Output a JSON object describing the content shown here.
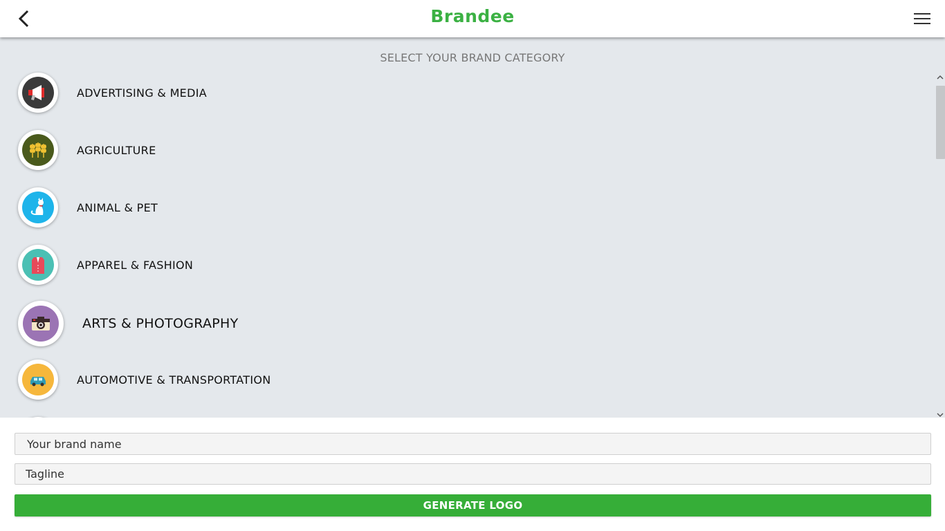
{
  "header": {
    "logo_text": "Brandee",
    "back_icon": "chevron-left-icon",
    "menu_icon": "hamburger-menu-icon"
  },
  "main": {
    "title": "SELECT YOUR BRAND CATEGORY",
    "categories": [
      {
        "label": "ADVERTISING & MEDIA",
        "icon": "megaphone-icon",
        "color": "#3a3a3a"
      },
      {
        "label": "AGRICULTURE",
        "icon": "wheat-icon",
        "color": "#4a5a1c"
      },
      {
        "label": "ANIMAL & PET",
        "icon": "cat-icon",
        "color": "#1eb4ea"
      },
      {
        "label": "APPAREL & FASHION",
        "icon": "vest-icon",
        "color": "#4bc0b4"
      },
      {
        "label": "ARTS & PHOTOGRAPHY",
        "icon": "camera-icon",
        "color": "#9b74b4"
      },
      {
        "label": "AUTOMOTIVE & TRANSPORTATION",
        "icon": "car-icon",
        "color": "#f6b73c"
      }
    ]
  },
  "form": {
    "brand_placeholder": "Your brand name",
    "tagline_placeholder": "Tagline",
    "generate_label": "GENERATE LOGO"
  },
  "colors": {
    "brand_green": "#36ae38",
    "list_background": "#e4e8ec"
  }
}
